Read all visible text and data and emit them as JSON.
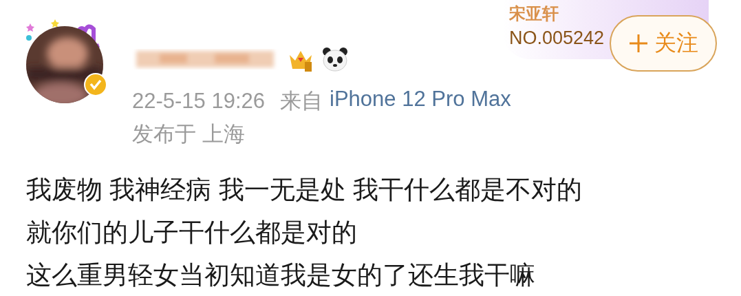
{
  "author": {
    "verified": true
  },
  "post": {
    "time": "22-5-15 19:26",
    "source_prefix": "来自",
    "source": "iPhone 12 Pro Max",
    "location": "发布于 上海"
  },
  "fan_badge": {
    "name": "宋亚轩",
    "number": "NO.005242"
  },
  "follow_button": {
    "label": "关注"
  },
  "body": [
    "我废物 我神经病 我一无是处 我干什么都是不对的",
    "就你们的儿子干什么都是对的",
    "这么重男轻女当初知道我是女的了还生我干嘛"
  ]
}
